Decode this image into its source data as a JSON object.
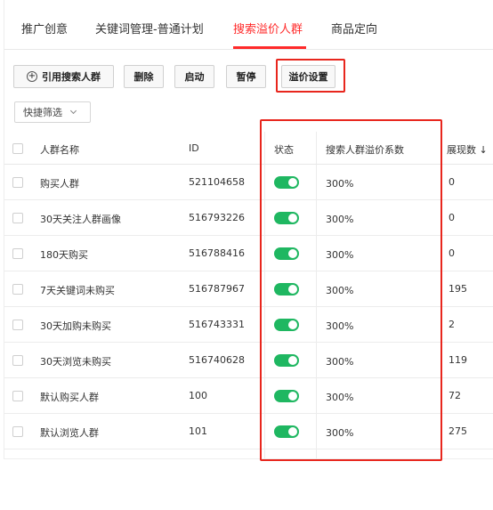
{
  "tabs": [
    {
      "label": "推广创意"
    },
    {
      "label": "关键词管理-普通计划"
    },
    {
      "label": "搜索溢价人群"
    },
    {
      "label": "商品定向"
    }
  ],
  "active_tab": "搜索溢价人群",
  "accent_color": "#ff2a2a",
  "toggle_on_color": "#1fb761",
  "toolbar": {
    "add_label": "引用搜索人群",
    "add_icon": "plus-circle-icon",
    "delete_label": "删除",
    "start_label": "启动",
    "pause_label": "暂停",
    "premium_label": "溢价设置"
  },
  "filter": {
    "label": "快捷筛选",
    "icon": "chevron-down-icon"
  },
  "table": {
    "headers": {
      "name": "人群名称",
      "id": "ID",
      "status": "状态",
      "premium": "搜索人群溢价系数",
      "impressions": "展现数 ↓"
    },
    "rows": [
      {
        "name": "购买人群",
        "id": "521104658",
        "status_on": true,
        "premium": "300%",
        "impressions": "0"
      },
      {
        "name": "30天关注人群画像",
        "id": "516793226",
        "status_on": true,
        "premium": "300%",
        "impressions": "0"
      },
      {
        "name": "180天购买",
        "id": "516788416",
        "status_on": true,
        "premium": "300%",
        "impressions": "0"
      },
      {
        "name": "7天关键词未购买",
        "id": "516787967",
        "status_on": true,
        "premium": "300%",
        "impressions": "195"
      },
      {
        "name": "30天加购未购买",
        "id": "516743331",
        "status_on": true,
        "premium": "300%",
        "impressions": "2"
      },
      {
        "name": "30天浏览未购买",
        "id": "516740628",
        "status_on": true,
        "premium": "300%",
        "impressions": "119"
      },
      {
        "name": "默认购买人群",
        "id": "100",
        "status_on": true,
        "premium": "300%",
        "impressions": "72"
      },
      {
        "name": "默认浏览人群",
        "id": "101",
        "status_on": true,
        "premium": "300%",
        "impressions": "275"
      }
    ]
  }
}
